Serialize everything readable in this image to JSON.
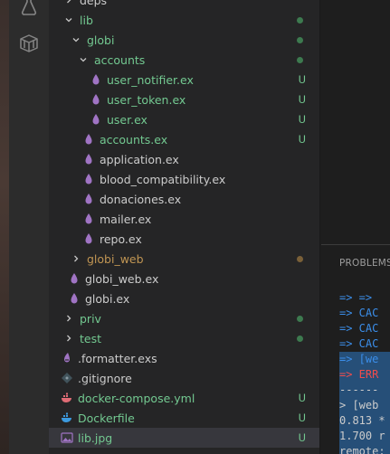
{
  "activity_bar": {
    "icons": [
      "flask-icon",
      "package-icon"
    ]
  },
  "explorer": {
    "rows": [
      {
        "label": "deps",
        "kind": "folder",
        "expanded": false,
        "depth": 1,
        "color": "default",
        "status": ""
      },
      {
        "label": "lib",
        "kind": "folder",
        "expanded": true,
        "depth": 1,
        "color": "green",
        "status": "dot"
      },
      {
        "label": "globi",
        "kind": "folder",
        "expanded": true,
        "depth": 2,
        "color": "green",
        "status": "dot"
      },
      {
        "label": "accounts",
        "kind": "folder",
        "expanded": true,
        "depth": 3,
        "color": "green",
        "status": "dot"
      },
      {
        "label": "user_notifier.ex",
        "kind": "elixir",
        "depth": 4,
        "color": "green",
        "status": "U"
      },
      {
        "label": "user_token.ex",
        "kind": "elixir",
        "depth": 4,
        "color": "green",
        "status": "U"
      },
      {
        "label": "user.ex",
        "kind": "elixir",
        "depth": 4,
        "color": "green",
        "status": "U"
      },
      {
        "label": "accounts.ex",
        "kind": "elixir",
        "depth": 3,
        "color": "green",
        "status": "U"
      },
      {
        "label": "application.ex",
        "kind": "elixir",
        "depth": 3,
        "color": "default",
        "status": ""
      },
      {
        "label": "blood_compatibility.ex",
        "kind": "elixir",
        "depth": 3,
        "color": "default",
        "status": ""
      },
      {
        "label": "donaciones.ex",
        "kind": "elixir",
        "depth": 3,
        "color": "default",
        "status": ""
      },
      {
        "label": "mailer.ex",
        "kind": "elixir",
        "depth": 3,
        "color": "default",
        "status": ""
      },
      {
        "label": "repo.ex",
        "kind": "elixir",
        "depth": 3,
        "color": "default",
        "status": ""
      },
      {
        "label": "globi_web",
        "kind": "folder",
        "expanded": false,
        "depth": 2,
        "color": "orange",
        "status": "dot-orange"
      },
      {
        "label": "globi_web.ex",
        "kind": "elixir",
        "depth": 2,
        "color": "default",
        "status": ""
      },
      {
        "label": "globi.ex",
        "kind": "elixir",
        "depth": 2,
        "color": "default",
        "status": ""
      },
      {
        "label": "priv",
        "kind": "folder",
        "expanded": false,
        "depth": 1,
        "color": "green",
        "status": "dot"
      },
      {
        "label": "test",
        "kind": "folder",
        "expanded": false,
        "depth": 1,
        "color": "green",
        "status": "dot"
      },
      {
        "label": ".formatter.exs",
        "kind": "formatter",
        "depth": 1,
        "color": "default",
        "status": ""
      },
      {
        "label": ".gitignore",
        "kind": "gitignore",
        "depth": 1,
        "color": "default",
        "status": ""
      },
      {
        "label": "docker-compose.yml",
        "kind": "docker-compose",
        "depth": 1,
        "color": "green",
        "status": "U"
      },
      {
        "label": "Dockerfile",
        "kind": "docker",
        "depth": 1,
        "color": "green",
        "status": "U"
      },
      {
        "label": "lib.jpg",
        "kind": "image",
        "depth": 1,
        "color": "green",
        "status": "U",
        "selected": true
      }
    ]
  },
  "panel": {
    "tab_label": "PROBLEMS"
  },
  "terminal": {
    "lines": [
      {
        "text": "=> =>",
        "color": "blue",
        "highlight": false
      },
      {
        "text": "=> CAC",
        "color": "blue",
        "highlight": false
      },
      {
        "text": "=> CAC",
        "color": "blue",
        "highlight": false
      },
      {
        "text": "=> CAC",
        "color": "blue",
        "highlight": false
      },
      {
        "text": "=> [we",
        "color": "blue",
        "highlight": true
      },
      {
        "text": "=> ERR",
        "color": "red",
        "highlight": true
      },
      {
        "text": "------",
        "color": "white",
        "highlight": true
      },
      {
        "text": "> [web",
        "color": "white",
        "highlight": true
      },
      {
        "text": "0.813 *",
        "color": "white",
        "highlight": true
      },
      {
        "text": "1.700 r",
        "color": "white",
        "highlight": true
      },
      {
        "text": "remote:",
        "color": "white",
        "highlight": true
      }
    ]
  },
  "colors": {
    "git_untracked": "#73c991",
    "folder_modified": "#c09553",
    "elixir_icon": "#a074c4",
    "docker_icon": "#3c9adf",
    "selection": "#37373d",
    "terminal_highlight": "#264f78"
  }
}
